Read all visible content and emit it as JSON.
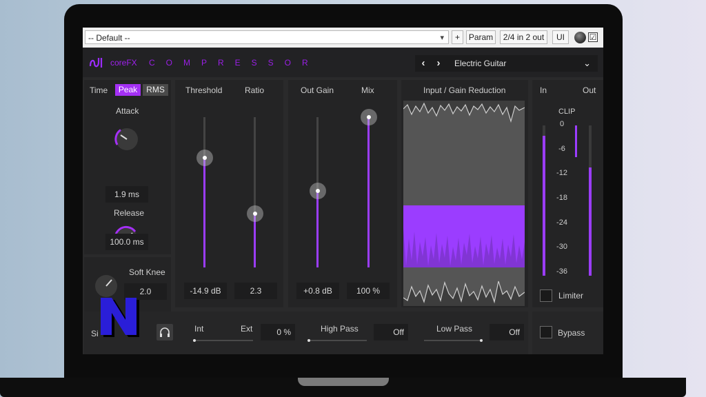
{
  "host": {
    "preset": "-- Default --",
    "plus": "+",
    "param": "Param",
    "io": "2/4 in 2 out",
    "ui": "UI",
    "check": "☑"
  },
  "plugin": {
    "brand": "coreFX",
    "title": "COMPRESSOR",
    "preset_prev": "‹",
    "preset_next": "›",
    "preset_name": "Electric Guitar",
    "preset_dropdown": "⌄",
    "accent": "#9b3dff"
  },
  "detector": {
    "time_label": "Time",
    "modes": [
      "Peak",
      "RMS"
    ],
    "active_mode": "Peak",
    "attack_label": "Attack",
    "attack_value": "1.9 ms",
    "release_label": "Release",
    "release_value": "100.0 ms",
    "soft_knee_label": "Soft Knee",
    "soft_knee_value": "2.0"
  },
  "sliders": {
    "threshold_label": "Threshold",
    "threshold_value": "-14.9 dB",
    "threshold_level": 0.73,
    "ratio_label": "Ratio",
    "ratio_value": "2.3",
    "ratio_level": 0.36,
    "outgain_label": "Out Gain",
    "outgain_value": "+0.8 dB",
    "outgain_level": 0.51,
    "mix_label": "Mix",
    "mix_value": "100 %",
    "mix_level": 1.0
  },
  "graph": {
    "label": "Input / Gain Reduction"
  },
  "meters": {
    "in_label": "In",
    "out_label": "Out",
    "clip_label": "CLIP",
    "scale": [
      "0",
      "-6",
      "-12",
      "-18",
      "-24",
      "-30",
      "-36"
    ],
    "in_level": 0.93,
    "out_level": 0.72,
    "limiter_label": "Limiter"
  },
  "bottom": {
    "sidechain_label": "Si",
    "headphone_icon": "headphones-icon",
    "int_label": "Int",
    "ext_label": "Ext",
    "intext_value": "0 %",
    "highpass_label": "High Pass",
    "highpass_value": "Off",
    "lowpass_label": "Low Pass",
    "lowpass_value": "Off",
    "bypass_label": "Bypass"
  }
}
